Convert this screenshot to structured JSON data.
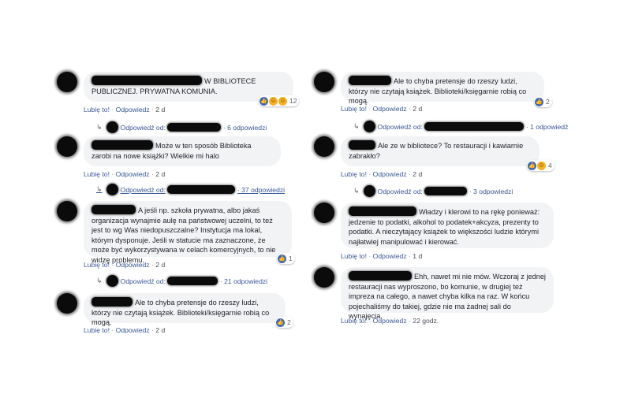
{
  "labels": {
    "like": "Lubię to!",
    "reply": "Odpowiedz",
    "sep": "·",
    "replied_by": "Odpowiedź od:"
  },
  "colors": {
    "bubble": "#f2f3f5",
    "link": "#385898",
    "like_badge": "#4267b2",
    "redaction": "#0b0b0b"
  },
  "icons": {
    "reply": "reply-arrow-icon",
    "like": "like-icon",
    "haha": "haha-icon"
  },
  "left": {
    "comments": [
      {
        "text_line1": "W BIBLIOTECE",
        "text_rest": "PUBLICZNEJ. PRYWATNA KOMUNIA.",
        "time": "2 d",
        "reaction_count": "12",
        "reply_count": "· 6 odpowiedzi"
      },
      {
        "text": "Może w ten sposób Biblioteka zarobi na nowe książki? Wielkie mi halo",
        "time": "2 d",
        "reply_count": "· 37 odpowiedzi"
      },
      {
        "text": "A jeśli np. szkoła prywatna, albo jakaś organizacja wynajmie aulę na państwowej uczelni, to też jest to wg Was niedopuszczalne? Instytucja ma lokal, którym dysponuje. Jeśli w statucie ma zaznaczone, że może być wykorzystywana w celach komercyjnych, to nie widzę problemu.",
        "time": "2 d",
        "reaction_count": "1",
        "reply_count": "· 21 odpowiedzi"
      },
      {
        "text": "Ale to chyba pretensje do rzeszy ludzi, którzy nie czytają książek. Biblioteki/księgarnie robią co mogą.",
        "time": "2 d",
        "reaction_count": "2"
      }
    ]
  },
  "right": {
    "comments": [
      {
        "text": "Ale to chyba pretensje do rzeszy ludzi, którzy nie czytają książek. Biblioteki/księgarnie robią co mogą.",
        "time": "2 d",
        "reaction_count": "2",
        "reply_count": "· 1 odpowiedź"
      },
      {
        "text": "Ale ze w bibliotece? To restauracji i kawiarnie zabrakło?",
        "time": "2 d",
        "reaction_count": "4",
        "reply_count": "· 3 odpowiedzi"
      },
      {
        "text": "Władzy i klerowi to na rękę ponieważ: jedzenie to podatki, alkohol to podatek+akcyza, prezenty to podatki. A nieczytający książek to większości ludzie którymi najłatwiej manipulować i kierować.",
        "time": "1 d"
      },
      {
        "text": "Ehh, nawet mi nie mów. Wczoraj z jednej restauracji nas wyproszono, bo komunie, w drugiej też impreza na całego, a nawet chyba kilka na raz. W końcu pojechaliśmy do takiej, gdzie nie ma żadnej sali do wynajęcia.",
        "time": "22 godz."
      }
    ]
  }
}
